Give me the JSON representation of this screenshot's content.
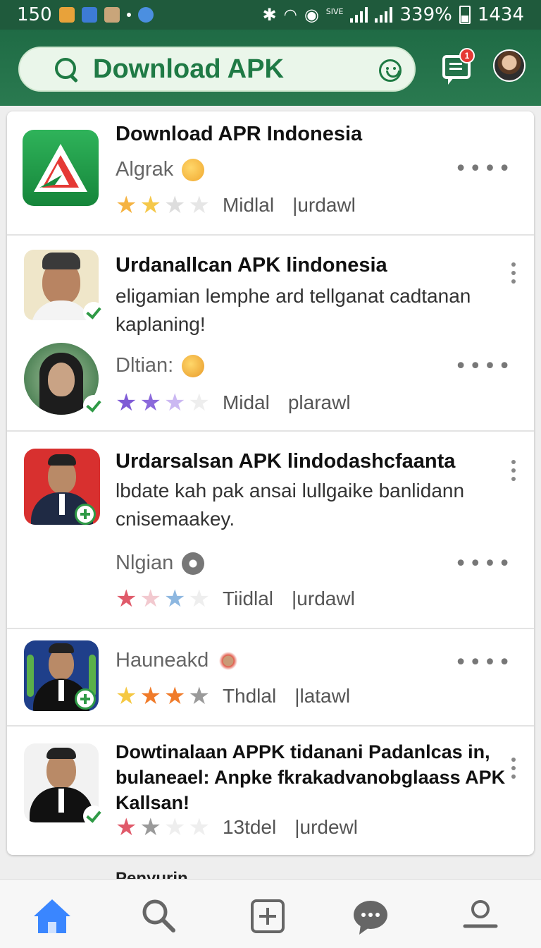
{
  "status_bar": {
    "time_left": "150",
    "signal_label": "SIVE",
    "battery_percent": "339%",
    "time_right": "1434"
  },
  "header": {
    "search_placeholder": "Download APK",
    "chat_badge": "1"
  },
  "apps": [
    {
      "title": "Download APR Indonesia",
      "developer": "Algrak",
      "rating_stars": 2,
      "meta1": "Midlal",
      "meta2": "|urdawl"
    },
    {
      "title": "Urdanallcan APK lindonesia",
      "description": "eligamian lemphe ard tellganat cadtanan kaplaning!",
      "developer": "Dltian:",
      "rating_stars": 2.5,
      "meta1": "Midal",
      "meta2": "plarawl"
    },
    {
      "title": "Urdarsalsan APK lindodashcfaanta",
      "description": "lbdate kah pak ansai lullgaike banlidann cnisemaakey.",
      "developer": "Nlgian",
      "rating_stars": 3,
      "meta1": "Tiidlal",
      "meta2": "|urdawl"
    },
    {
      "title": "Hauneakd",
      "rating_stars": 3,
      "meta1": "Thdlal",
      "meta2": "|latawl"
    },
    {
      "title": "Dowtinalaan APPK tidanani Padanlcas in, bulaneael: Anpke fkrakadvanobglaass APK Kallsan!",
      "rating_stars": 2,
      "meta1": "13tdel",
      "meta2": "|urdewl"
    }
  ],
  "peek_title": "Penyurin",
  "nav": [
    "Home",
    "Search",
    "Add",
    "Chat",
    "Profile"
  ],
  "colors": {
    "header_green": "#1f6b45",
    "accent_green": "#1e7a43",
    "nav_active": "#3a86ff"
  }
}
